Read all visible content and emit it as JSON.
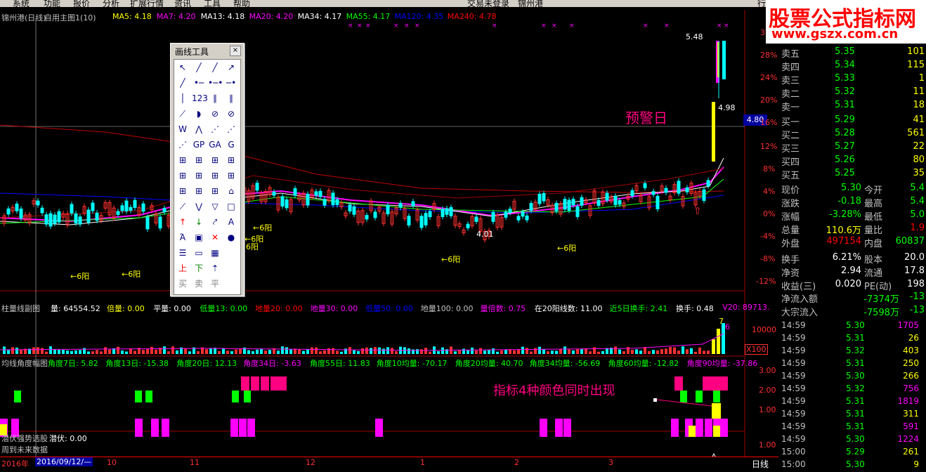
{
  "menu": {
    "items": [
      "系统",
      "功能",
      "报价",
      "分析",
      "扩展行情",
      "资讯",
      "工具",
      "帮助"
    ],
    "status": "交易未登录",
    "stock_short": "锦州港",
    "right_tab": "行"
  },
  "watermark": {
    "line1": "股票公式指标网",
    "line2": "www.gszx.com.cn"
  },
  "main_chart": {
    "title": "锦州港(日线)",
    "formula": "自用主图1(10)",
    "ma": [
      {
        "label": "MA5: 4.18",
        "color": "#ffff00"
      },
      {
        "label": "MA7: 4.20",
        "color": "#ff00ff"
      },
      {
        "label": "MA13: 4.18",
        "color": "#ffffff"
      },
      {
        "label": "MA20: 4.20",
        "color": "#ff00ff"
      },
      {
        "label": "MA34: 4.17",
        "color": "#ffffff"
      },
      {
        "label": "MA55: 4.17",
        "color": "#00ff00"
      },
      {
        "label": "MA120: 4.35",
        "color": "#0000ff"
      },
      {
        "label": "MA240: 4.78",
        "color": "#ff0000"
      }
    ],
    "pct_axis": [
      "32%",
      "28%",
      "24%",
      "20%",
      "16%",
      "12%",
      "8%",
      "4%",
      "0%",
      "-4%",
      "-8%",
      "-12%"
    ],
    "current_price_tag": "4.80",
    "high_label": "5.48",
    "low_label": "4.01",
    "price_label_2": "4.98",
    "warning_text": "预警日",
    "sixyang": [
      "←6阳",
      "←6阳",
      "←6阳",
      "←6阳",
      "←6阳",
      "←6阳",
      "6阳"
    ]
  },
  "volume_panel": {
    "title": "柱量线副图",
    "fields": [
      {
        "text": "量: 64554.52",
        "color": "#ffffff"
      },
      {
        "text": "倍量: 0.00",
        "color": "#ffff00"
      },
      {
        "text": "平量: 0.00",
        "color": "#ffffff"
      },
      {
        "text": "低量13: 0.00",
        "color": "#00ff00"
      },
      {
        "text": "地量20: 0.00",
        "color": "#ff0000"
      },
      {
        "text": "地量30: 0.00",
        "color": "#ff00ff"
      },
      {
        "text": "低量50: 0.00",
        "color": "#0000ff"
      },
      {
        "text": "地量100: 0.00",
        "color": "#c0c0c0"
      },
      {
        "text": "量倍数: 0.75",
        "color": "#ff00ff"
      },
      {
        "text": "在20阳线数: 11.00",
        "color": "#ffffff"
      },
      {
        "text": "近5日换手: 2.41",
        "color": "#00ff00"
      },
      {
        "text": "换手: 0.48",
        "color": "#ffffff"
      },
      {
        "text": "V20: 89713.",
        "color": "#ff00ff"
      }
    ],
    "axis_label": "10000",
    "scale": "X100",
    "marks": [
      "7",
      "6"
    ]
  },
  "angle_panel": {
    "title": "均线角度幅图",
    "fields": [
      {
        "text": "角度7日: 5.82",
        "color": "#00ff00"
      },
      {
        "text": "角度13日: -15.38",
        "color": "#00ff00"
      },
      {
        "text": "角度20日: 12.13",
        "color": "#00ff00"
      },
      {
        "text": "角度34日: -3.63",
        "color": "#ff00ff"
      },
      {
        "text": "角度55日: 11.83",
        "color": "#00ff00"
      },
      {
        "text": "角度10均量: -70.17",
        "color": "#00ff00"
      },
      {
        "text": "角度20均量: 40.70",
        "color": "#00ff00"
      },
      {
        "text": "角度34均量: -56.69",
        "color": "#00ff00"
      },
      {
        "text": "角度60均量: -12.82",
        "color": "#00ff00"
      },
      {
        "text": "角度90均量: -37.86",
        "color": "#ff00ff"
      }
    ],
    "axis": [
      "3.00",
      "2.00",
      "1.00"
    ],
    "annotation": "指标4种颜色同时出现"
  },
  "latent_panel": {
    "title": "潜伏强势选股",
    "value": "潜伏: 0.00",
    "note": "周到未来数据",
    "axis": "1.00"
  },
  "date_axis": {
    "items": [
      "2016年",
      "2016/09/12/—",
      "10",
      "11",
      "12",
      "1",
      "2",
      "3"
    ],
    "period": "日线"
  },
  "toolbox": {
    "title": "画线工具",
    "close": "×",
    "tools": [
      "↖",
      "╱",
      "╱",
      "↗",
      "╱",
      "•─",
      "•─•",
      "─•",
      "│",
      "123",
      "∥",
      "∥",
      "⟋",
      "◗",
      "⊘",
      "⊘",
      "W",
      "⋀",
      "⋰",
      "⋰",
      "⋰",
      "GP",
      "GA",
      "G",
      "⊞",
      "⊞",
      "⊞",
      "⊞",
      "⊞",
      "⊞",
      "⊞",
      "⊞",
      "⊞",
      "⊞",
      "⊞",
      "⌂",
      "⟋",
      "⋁",
      "▽",
      "□",
      "↑",
      "↓",
      "⤤",
      "A",
      "Ά",
      "▣",
      "✕",
      "●",
      "☰",
      "▭",
      "▦",
      "",
      "上",
      "下",
      "⇡",
      "",
      "买",
      "卖",
      "平",
      ""
    ]
  },
  "quote_panel": {
    "asks": [
      {
        "label": "卖五",
        "price": "5.35",
        "vol": "101"
      },
      {
        "label": "卖四",
        "price": "5.34",
        "vol": "115"
      },
      {
        "label": "卖三",
        "price": "5.33",
        "vol": "1"
      },
      {
        "label": "卖二",
        "price": "5.32",
        "vol": "11"
      },
      {
        "label": "卖一",
        "price": "5.31",
        "vol": "18"
      }
    ],
    "bids": [
      {
        "label": "买一",
        "price": "5.29",
        "vol": "41"
      },
      {
        "label": "买二",
        "price": "5.28",
        "vol": "561"
      },
      {
        "label": "买三",
        "price": "5.27",
        "vol": "22"
      },
      {
        "label": "买四",
        "price": "5.26",
        "vol": "80"
      },
      {
        "label": "买五",
        "price": "5.25",
        "vol": "35"
      }
    ],
    "stats": [
      {
        "l1": "现价",
        "v1": "5.30",
        "l2": "今开",
        "v2": "5.4",
        "c1": "#00ff00",
        "c2": "#00ff00"
      },
      {
        "l1": "涨跌",
        "v1": "-0.18",
        "l2": "最高",
        "v2": "5.4",
        "c1": "#00ff00",
        "c2": "#00ff00"
      },
      {
        "l1": "涨幅",
        "v1": "-3.28%",
        "l2": "最低",
        "v2": "5.0",
        "c1": "#00ff00",
        "c2": "#00ff00"
      },
      {
        "l1": "总量",
        "v1": "110.6万",
        "l2": "量比",
        "v2": "1.9",
        "c1": "#ffff00",
        "c2": "#ff0000"
      },
      {
        "l1": "外盘",
        "v1": "497154",
        "l2": "内盘",
        "v2": "60837",
        "c1": "#ff0000",
        "c2": "#00ff00"
      },
      {
        "l1": "换手",
        "v1": "6.21%",
        "l2": "股本",
        "v2": "20.0",
        "c1": "#ffffff",
        "c2": "#ffffff"
      },
      {
        "l1": "净资",
        "v1": "2.94",
        "l2": "流通",
        "v2": "17.8",
        "c1": "#ffffff",
        "c2": "#ffffff"
      },
      {
        "l1": "收益(三)",
        "v1": "0.020",
        "l2": "PE(动)",
        "v2": "198",
        "c1": "#ffffff",
        "c2": "#ffffff"
      }
    ],
    "flows": [
      {
        "label": "净流入额",
        "value": "-7374万",
        "tail": "-13"
      },
      {
        "label": "大宗流入",
        "value": "-7598万",
        "tail": "-13"
      }
    ],
    "ticks": [
      {
        "time": "14:59",
        "price": "5.30",
        "vol": "1705",
        "vc": "#ff00ff",
        "pc": "#00ff00"
      },
      {
        "time": "14:59",
        "price": "5.31",
        "vol": "26",
        "vc": "#ffff00",
        "pc": "#00ff00"
      },
      {
        "time": "14:59",
        "price": "5.32",
        "vol": "403",
        "vc": "#ffff00",
        "pc": "#00ff00"
      },
      {
        "time": "14:59",
        "price": "5.31",
        "vol": "250",
        "vc": "#ffff00",
        "pc": "#00ff00"
      },
      {
        "time": "14:59",
        "price": "5.30",
        "vol": "266",
        "vc": "#ffff00",
        "pc": "#00ff00"
      },
      {
        "time": "14:59",
        "price": "5.32",
        "vol": "756",
        "vc": "#ff00ff",
        "pc": "#00ff00"
      },
      {
        "time": "14:59",
        "price": "5.31",
        "vol": "1819",
        "vc": "#ff00ff",
        "pc": "#00ff00"
      },
      {
        "time": "14:59",
        "price": "5.31",
        "vol": "311",
        "vc": "#ffff00",
        "pc": "#00ff00"
      },
      {
        "time": "14:59",
        "price": "5.31",
        "vol": "591",
        "vc": "#ff00ff",
        "pc": "#00ff00"
      },
      {
        "time": "14:59",
        "price": "5.30",
        "vol": "1224",
        "vc": "#ff00ff",
        "pc": "#00ff00"
      },
      {
        "time": "15:00",
        "price": "5.29",
        "vol": "261",
        "vc": "#ffff00",
        "pc": "#00ff00"
      },
      {
        "time": "15:00",
        "price": "5.30",
        "vol": "9",
        "vc": "#ffff00",
        "pc": "#00ff00"
      }
    ]
  }
}
